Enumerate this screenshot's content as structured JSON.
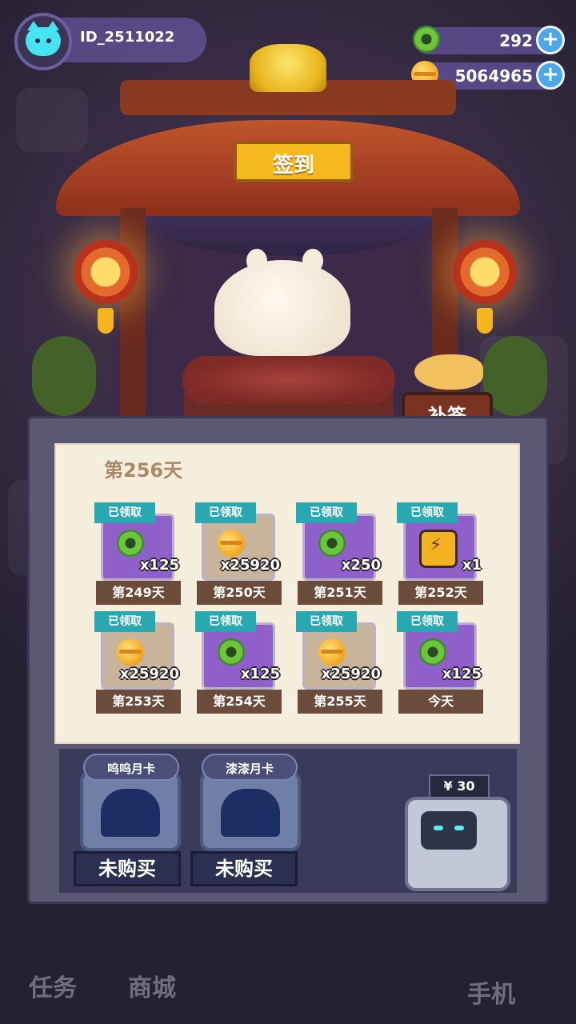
{
  "player": {
    "id": "ID_2511022"
  },
  "currency": {
    "jade": {
      "icon": "jade-coin-icon",
      "value": "292"
    },
    "gold": {
      "icon": "gold-coin-icon",
      "value": "5064965"
    }
  },
  "shrine": {
    "sign": "签到",
    "makeup_button": "补签"
  },
  "checkin": {
    "current_day": "第256天",
    "cards": [
      {
        "status": "已领取",
        "item": "jade",
        "qty": "x125",
        "day": "第249天",
        "bg": "purple"
      },
      {
        "status": "已领取",
        "item": "gold",
        "qty": "x25920",
        "day": "第250天",
        "bg": "tan"
      },
      {
        "status": "已领取",
        "item": "jade",
        "qty": "x250",
        "day": "第251天",
        "bg": "purple"
      },
      {
        "status": "已领取",
        "item": "battery",
        "qty": "x1",
        "day": "第252天",
        "bg": "purple"
      },
      {
        "status": "已领取",
        "item": "gold",
        "qty": "x25920",
        "day": "第253天",
        "bg": "tan"
      },
      {
        "status": "已领取",
        "item": "jade",
        "qty": "x125",
        "day": "第254天",
        "bg": "purple"
      },
      {
        "status": "已领取",
        "item": "gold",
        "qty": "x25920",
        "day": "第255天",
        "bg": "tan"
      },
      {
        "status": "已领取",
        "item": "jade",
        "qty": "x125",
        "day": "今天",
        "bg": "purple"
      }
    ]
  },
  "monthly_cards": [
    {
      "name": "呜呜月卡",
      "status": "未购买"
    },
    {
      "name": "漆漆月卡",
      "status": "未购买"
    }
  ],
  "shop": {
    "price": "¥ 30"
  },
  "bottom_nav": {
    "tasks": "任务",
    "store": "商城",
    "phone": "手机"
  }
}
